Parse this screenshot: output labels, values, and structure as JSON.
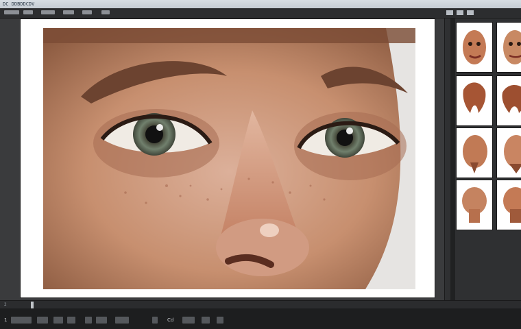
{
  "app": {
    "window_title": "DC DDBDDCDV",
    "top_icons": [
      "app-icon",
      "minimize-icon",
      "restore-icon"
    ]
  },
  "timeline": {
    "frame_label": "2"
  },
  "status": {
    "left_label": "1",
    "zoom_label": "Cd"
  },
  "thumbnails": [
    {
      "name": "thumb-face-1"
    },
    {
      "name": "thumb-face-2"
    },
    {
      "name": "thumb-sculpt-1"
    },
    {
      "name": "thumb-sculpt-2"
    },
    {
      "name": "thumb-head-1"
    },
    {
      "name": "thumb-head-2"
    },
    {
      "name": "thumb-head-3"
    },
    {
      "name": "thumb-head-4"
    }
  ],
  "colors": {
    "workspace": "#3a3b3d",
    "panel": "#2f3032",
    "skin": "#c99a7b"
  }
}
